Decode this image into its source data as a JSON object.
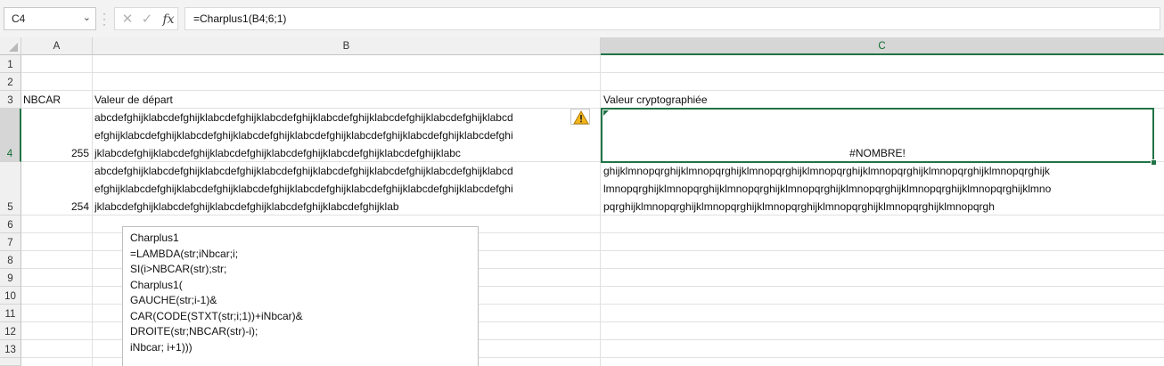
{
  "name_box": {
    "value": "C4"
  },
  "formula_bar": {
    "formula": "=Charplus1(B4;6;1)"
  },
  "icons": {
    "cancel": "x-icon",
    "enter": "check-icon",
    "function": "fx-icon",
    "warning": "warning-icon"
  },
  "columns": [
    "A",
    "B",
    "C"
  ],
  "rows": [
    "1",
    "2",
    "3",
    "4",
    "5",
    "6",
    "7",
    "8",
    "9",
    "10",
    "11",
    "12",
    "13"
  ],
  "cells": {
    "A3": "NBCAR",
    "B3": "Valeur de départ",
    "C3": "Valeur cryptographiée",
    "A4": "255",
    "B4": [
      "abcdefghijklabcdefghijklabcdefghijklabcdefghijklabcdefghijklabcdefghijklabcdefghijklabcd",
      "efghijklabcdefghijklabcdefghijklabcdefghijklabcdefghijklabcdefghijklabcdefghijklabcdefghi",
      "jklabcdefghijklabcdefghijklabcdefghijklabcdefghijklabcdefghijklabcdefghijklabc"
    ],
    "C4": "#NOMBRE!",
    "A5": "254",
    "B5": [
      "abcdefghijklabcdefghijklabcdefghijklabcdefghijklabcdefghijklabcdefghijklabcdefghijklabcd",
      "efghijklabcdefghijklabcdefghijklabcdefghijklabcdefghijklabcdefghijklabcdefghijklabcdefghi",
      "jklabcdefghijklabcdefghijklabcdefghijklabcdefghijklabcdefghijklab"
    ],
    "C5": [
      "ghijklmnopqrghijklmnopqrghijklmnopqrghijklmnopqrghijklmnopqrghijklmnopqrghijklmnopqrghijk",
      "lmnopqrghijklmnopqrghijklmnopqrghijklmnopqrghijklmnopqrghijklmnopqrghijklmnopqrghijklmno",
      "pqrghijklmnopqrghijklmnopqrghijklmnopqrghijklmnopqrghijklmnopqrghijklmnopqrgh"
    ]
  },
  "textbox": {
    "lines": [
      "Charplus1",
      "=LAMBDA(str;iNbcar;i;",
      "SI(i>NBCAR(str);str;",
      "Charplus1(",
      "GAUCHE(str;i-1)&",
      "CAR(CODE(STXT(str;i;1))+iNbcar)&",
      "DROITE(str;NBCAR(str)-i);",
      "iNbcar; i+1)))"
    ]
  },
  "colors": {
    "selection": "#217346",
    "header_bg": "#f0f0f0",
    "selected_header_bg": "#d6d6d6",
    "warning": "#e8a200"
  }
}
